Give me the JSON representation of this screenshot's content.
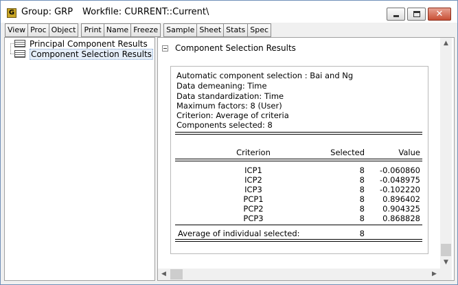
{
  "window": {
    "app_icon_letter": "G",
    "title_group": "Group: GRP",
    "title_workfile": "Workfile: CURRENT::Current\\",
    "controls": {
      "minimize": "minimize-icon",
      "maximize": "maximize-icon",
      "close": "close-icon"
    }
  },
  "toolbar": {
    "buttons": [
      "View",
      "Proc",
      "Object",
      "Print",
      "Name",
      "Freeze",
      "Sample",
      "Sheet",
      "Stats",
      "Spec"
    ]
  },
  "tree": {
    "items": [
      {
        "label": "Principal Component Results",
        "icon": "table-icon"
      },
      {
        "label": "Component Selection Results",
        "icon": "table-icon",
        "selected": true
      }
    ]
  },
  "output": {
    "section_title": "Component Selection Results",
    "info": [
      "Automatic component selection : Bai and Ng",
      "Data demeaning: Time",
      "Data standardization: Time",
      "Maximum factors: 8 (User)",
      "Criterion: Average of criteria",
      "Components selected: 8"
    ],
    "table": {
      "headers": {
        "criterion": "Criterion",
        "selected": "Selected",
        "value": "Value"
      },
      "rows": [
        {
          "criterion": "ICP1",
          "selected": "8",
          "value": "-0.060860"
        },
        {
          "criterion": "ICP2",
          "selected": "8",
          "value": "-0.048975"
        },
        {
          "criterion": "ICP3",
          "selected": "8",
          "value": "-0.102220"
        },
        {
          "criterion": "PCP1",
          "selected": "8",
          "value": "0.896402"
        },
        {
          "criterion": "PCP2",
          "selected": "8",
          "value": "0.904325"
        },
        {
          "criterion": "PCP3",
          "selected": "8",
          "value": "0.868828"
        }
      ],
      "footer": {
        "label": "Average of individual selected:",
        "selected": "8"
      }
    }
  },
  "colors": {
    "window_border": "#6f8fb8",
    "close_button": "#c74f35",
    "selection": "#e5eef9"
  }
}
